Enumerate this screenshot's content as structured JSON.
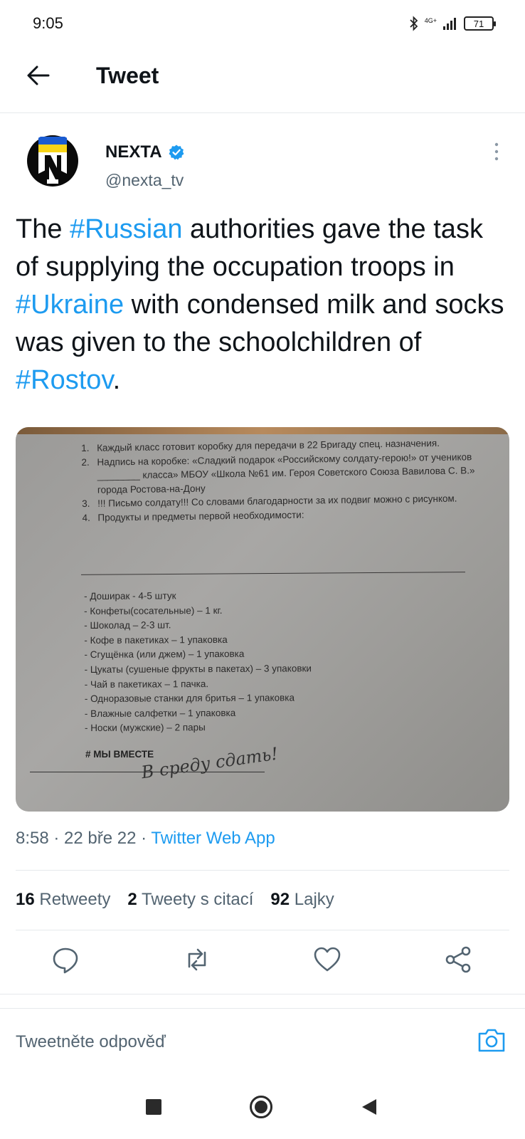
{
  "status_bar": {
    "time": "9:05",
    "network": "4G+",
    "battery": "71",
    "icons": [
      "bluetooth-icon",
      "signal-icon",
      "battery-icon"
    ]
  },
  "header": {
    "title": "Tweet",
    "back_icon": "arrow-left-icon"
  },
  "author": {
    "name": "NEXTA",
    "handle": "@nexta_tv",
    "verified": true,
    "avatar_letter": "N"
  },
  "tweet": {
    "parts": [
      {
        "text": "The ",
        "type": "text"
      },
      {
        "text": "#Russian",
        "type": "hashtag"
      },
      {
        "text": " authorities gave the task of supplying the occupation troops in ",
        "type": "text"
      },
      {
        "text": "#Ukraine",
        "type": "hashtag"
      },
      {
        "text": " with condensed milk and socks was given to the schoolchildren of ",
        "type": "text"
      },
      {
        "text": "#Rostov",
        "type": "hashtag"
      },
      {
        "text": ".",
        "type": "text"
      }
    ]
  },
  "photo": {
    "numbered": [
      {
        "n": "1.",
        "text": "Каждый класс готовит коробку для передачи в 22 Бригаду спец. назначения."
      },
      {
        "n": "2.",
        "text": "Надпись на коробке: «Сладкий подарок «Российскому солдату-герою!» от учеников ________ класса» МБОУ «Школа №61 им. Героя Советского Союза Вавилова С. В.» города Ростова-на-Дону"
      },
      {
        "n": "3.",
        "text": "!!! Письмо солдату!!! Со словами благодарности за их подвиг можно с рисунком."
      },
      {
        "n": "4.",
        "text": "Продукты и предметы первой необходимости:"
      }
    ],
    "items": [
      "- Доширак - 4-5 штук",
      "- Конфеты(сосательные) – 1 кг.",
      "- Шоколад – 2-3 шт.",
      "- Кофе в пакетиках – 1 упаковка",
      "- Сгущёнка (или джем) – 1 упаковка",
      "- Цукаты (сушеные фрукты в пакетах) – 3 упаковки",
      "- Чай в пакетиках – 1 пачка.",
      "- Одноразовые станки для бритья – 1 упаковка",
      "- Влажные салфетки – 1 упаковка",
      "- Носки (мужские) – 2 пары"
    ],
    "tag": "# МЫ ВМЕСТЕ",
    "handwriting": "В среду сдать!"
  },
  "meta": {
    "time": "8:58",
    "sep": " · ",
    "date": "22 bře 22",
    "source": "Twitter Web App"
  },
  "stats": {
    "retweets_count": "16",
    "retweets_label": "Retweety",
    "quotes_count": "2",
    "quotes_label": "Tweety s citací",
    "likes_count": "92",
    "likes_label": "Lajky"
  },
  "actions": [
    "reply-icon",
    "retweet-icon",
    "like-icon",
    "share-icon"
  ],
  "reply_bar": {
    "placeholder": "Tweetněte odpověď",
    "icon": "camera-icon"
  },
  "nav": [
    "recent-apps-icon",
    "home-icon",
    "back-triangle-icon"
  ],
  "colors": {
    "accent": "#1d9bf0",
    "text": "#0f1419",
    "secondary": "#536471",
    "divider": "#e6e9ec"
  }
}
